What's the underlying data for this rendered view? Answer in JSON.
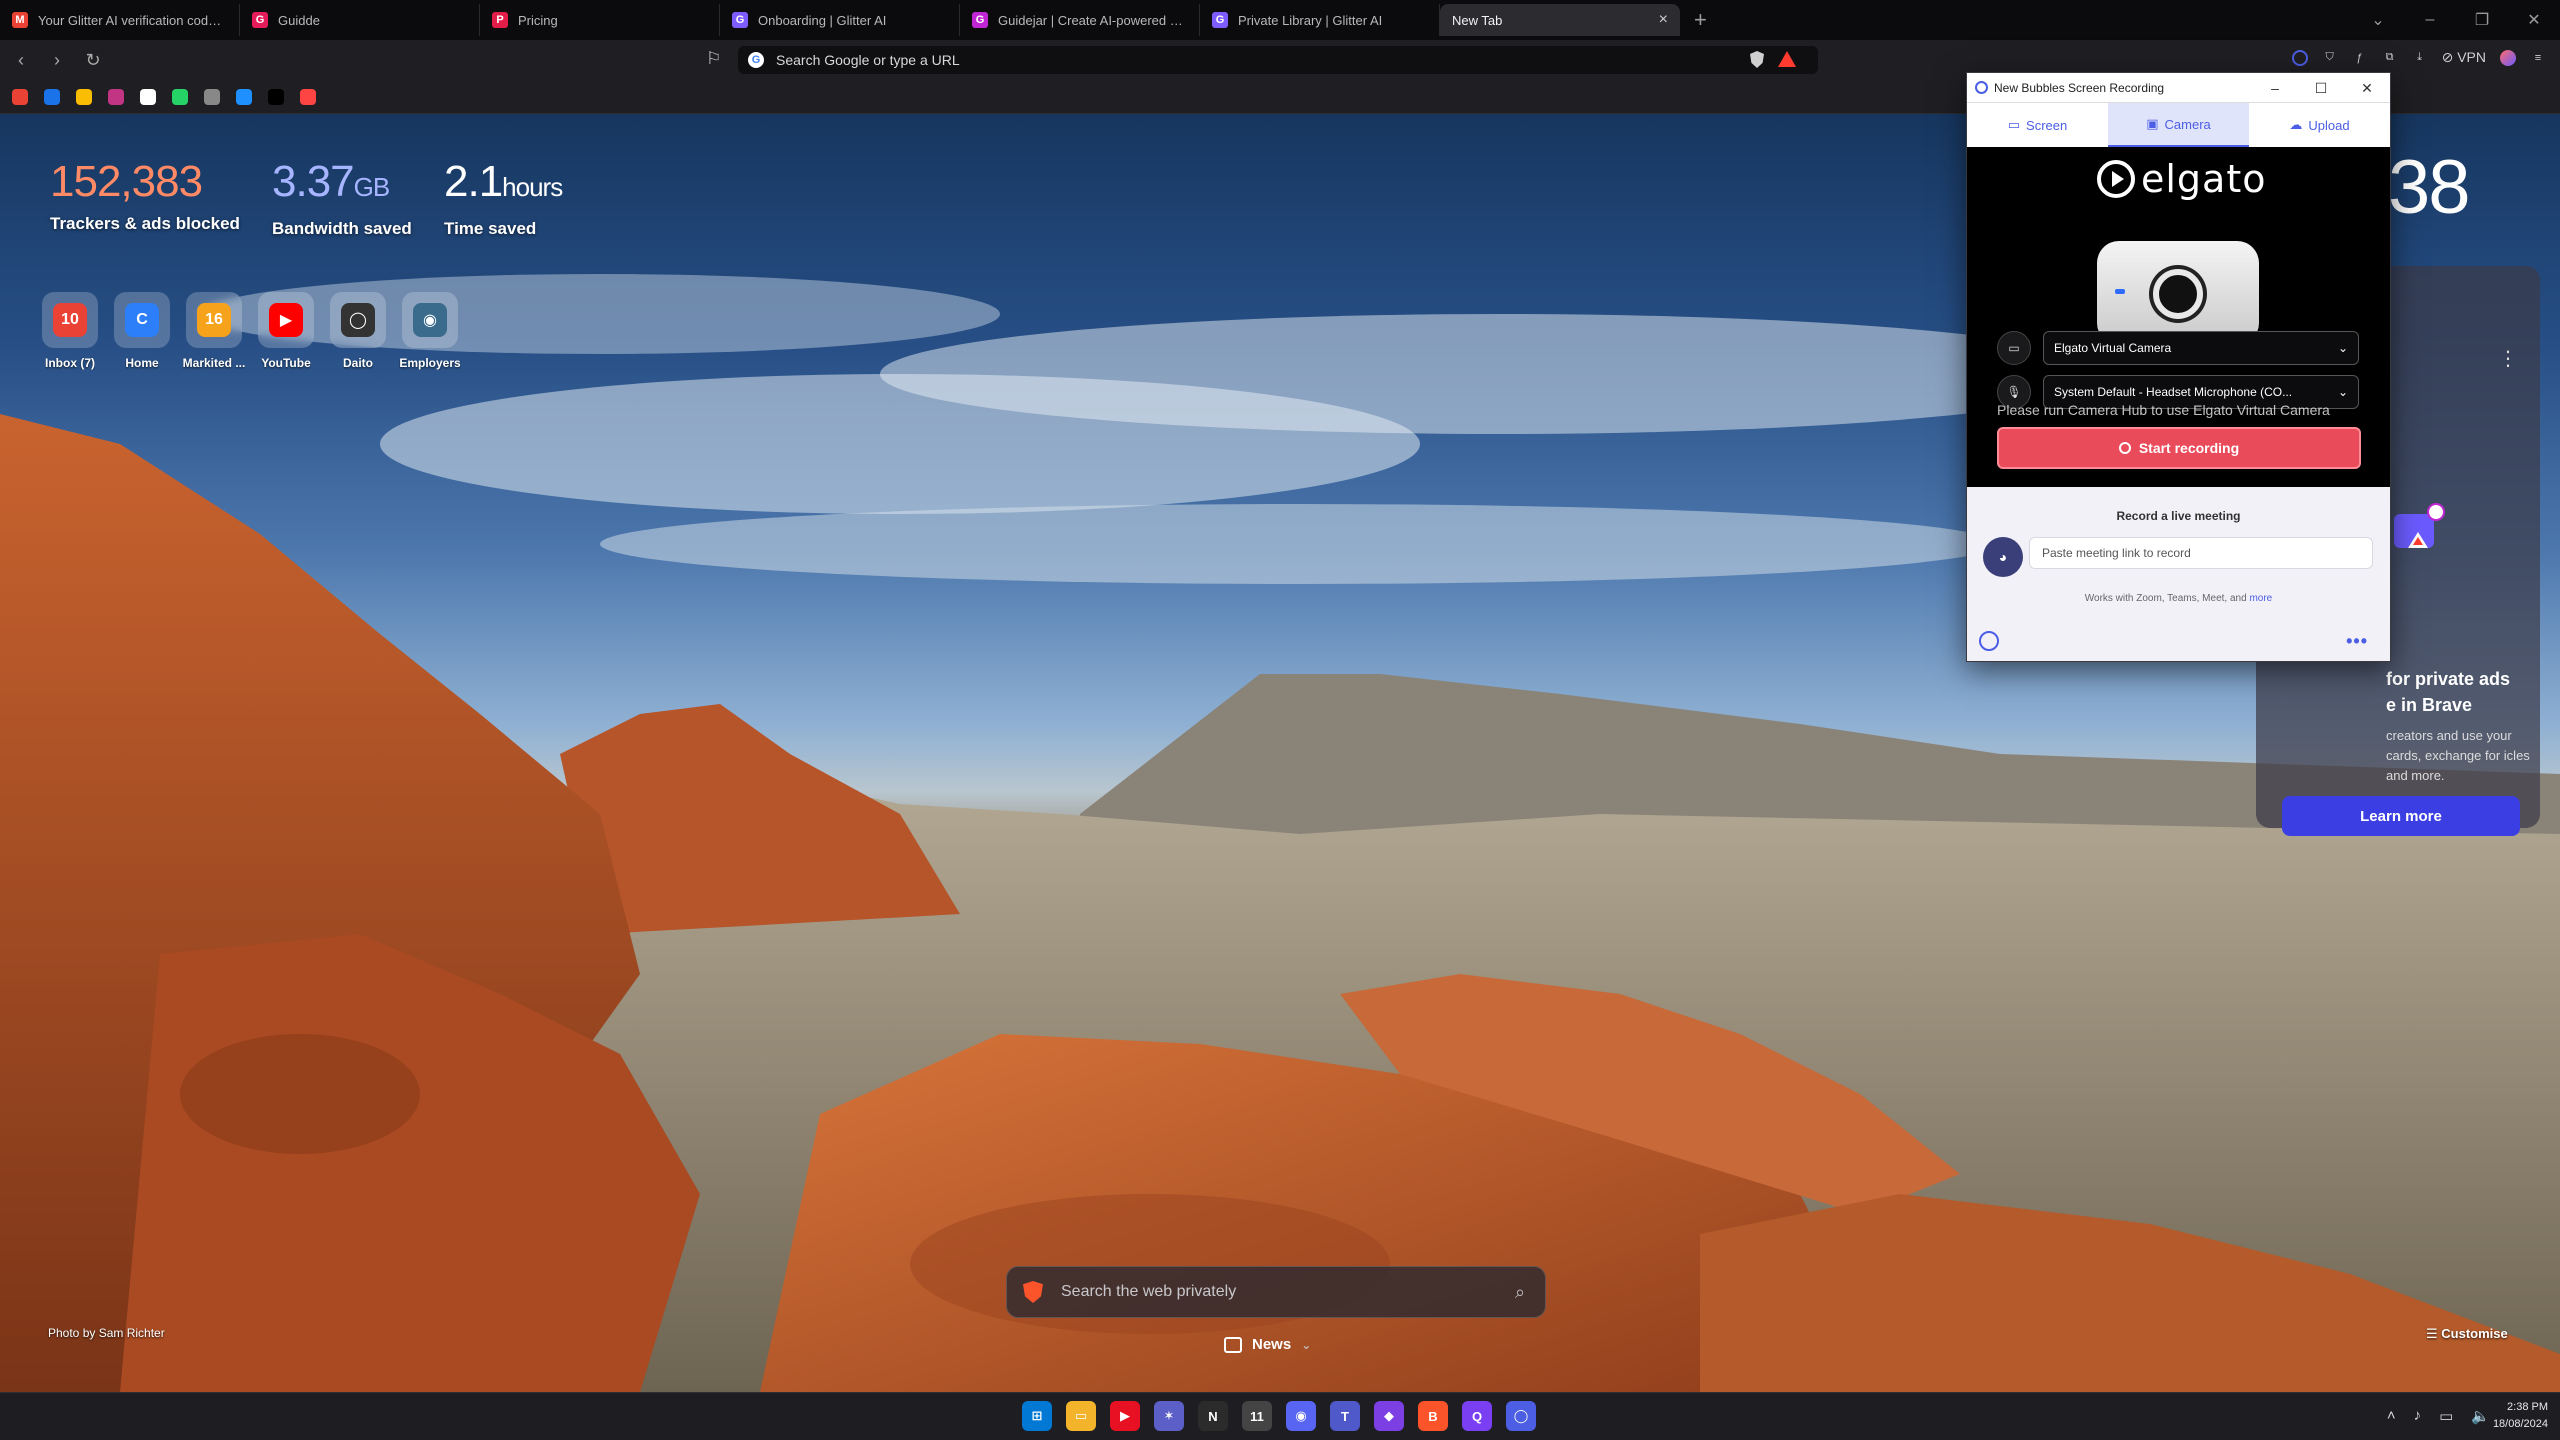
{
  "tabs": [
    {
      "title": "Your Glitter AI verification code - p...",
      "favicon_color": "#ea4335",
      "favicon_glyph": "M"
    },
    {
      "title": "Guidde",
      "favicon_color": "#e61b5a",
      "favicon_glyph": "G"
    },
    {
      "title": "Pricing",
      "favicon_color": "#e11d48",
      "favicon_glyph": "P"
    },
    {
      "title": "Onboarding | Glitter AI",
      "favicon_color": "#7c5cff",
      "favicon_glyph": "G"
    },
    {
      "title": "Guidejar | Create AI-powered step-...",
      "favicon_color": "#c026d3",
      "favicon_glyph": "G"
    },
    {
      "title": "Private Library | Glitter AI",
      "favicon_color": "#7c5cff",
      "favicon_glyph": "G"
    },
    {
      "title": "New Tab",
      "favicon_color": "",
      "favicon_glyph": ""
    }
  ],
  "new_tab_glyph": "+",
  "toolbar": {
    "url_placeholder": "Search Google or type a URL",
    "vpn_label": "VPN"
  },
  "bookmark_colors": [
    "#ea4335",
    "#1a73e8",
    "#fbbc04",
    "#c13584",
    "#ffffff",
    "#25d366",
    "#888888",
    "#1e90ff",
    "#000000",
    "#ff4444"
  ],
  "stats": {
    "trackers_value": "152,383",
    "trackers_label": "Trackers & ads blocked",
    "bandwidth_value": "3.37",
    "bandwidth_unit": "GB",
    "bandwidth_label": "Bandwidth saved",
    "time_value": "2.1",
    "time_unit": "hours",
    "time_label": "Time saved",
    "colors": {
      "trackers": "#ff8a65",
      "bandwidth": "#a7b4ff",
      "time": "#ffffff"
    }
  },
  "top_sites": [
    {
      "name": "Inbox (7)",
      "badge": "10",
      "color": "#ea4335",
      "icon": "gmail-icon"
    },
    {
      "name": "Home",
      "badge": "C",
      "color": "#2d7ff9",
      "icon": "canva-icon"
    },
    {
      "name": "Markited ...",
      "badge": "16",
      "color": "#f7a21b",
      "icon": "calendar-icon"
    },
    {
      "name": "YouTube",
      "badge": "▶",
      "color": "#ff0000",
      "icon": "youtube-icon"
    },
    {
      "name": "Daito",
      "badge": "◯",
      "color": "#333333",
      "icon": "daito-icon"
    },
    {
      "name": "Employers",
      "badge": "◉",
      "color": "#3a6b8c",
      "icon": "employers-icon"
    }
  ],
  "clock_fragment": "38",
  "promo": {
    "headline_1": "for private ads",
    "headline_2": "e in Brave",
    "body": "creators and use your cards, exchange for icles and more.",
    "button": "Learn more"
  },
  "search": {
    "placeholder": "Search the web privately"
  },
  "news_label": "News",
  "photo_credit": "Photo by Sam Richter",
  "customise_label": "Customise",
  "bubbles": {
    "window_title": "New Bubbles Screen Recording",
    "tabs": [
      {
        "label": "Screen",
        "icon": "monitor-icon"
      },
      {
        "label": "Camera",
        "icon": "camera-icon",
        "active": true
      },
      {
        "label": "Upload",
        "icon": "cloud-upload-icon"
      }
    ],
    "brand_text": "elgato",
    "camera_select": "Elgato Virtual Camera",
    "mic_select": "System Default - Headset Microphone (CO...",
    "hint_text": "Please run Camera Hub to use Elgato Virtual Camera",
    "start_button": "Start recording",
    "meeting_heading": "Record a live meeting",
    "meeting_placeholder": "Paste meeting link to record",
    "works_with": "Works with Zoom, Teams, Meet, and",
    "works_more": "more",
    "start_color": "#ea4b5a",
    "accent_color": "#4b5ee4"
  },
  "taskbar": {
    "apps": [
      {
        "name": "windows-start",
        "color": "#0078d4",
        "glyph": "⊞"
      },
      {
        "name": "file-explorer",
        "color": "#f3b32a",
        "glyph": "▭"
      },
      {
        "name": "media-player",
        "color": "#e81123",
        "glyph": "▶"
      },
      {
        "name": "app-star",
        "color": "#5b5fc7",
        "glyph": "✶"
      },
      {
        "name": "notion",
        "color": "#2b2b2b",
        "glyph": "N"
      },
      {
        "name": "calendar",
        "color": "#444444",
        "glyph": "11"
      },
      {
        "name": "discord",
        "color": "#5865f2",
        "glyph": "◉"
      },
      {
        "name": "teams",
        "color": "#5059c9",
        "glyph": "T"
      },
      {
        "name": "clipchamp",
        "color": "#7b3fe4",
        "glyph": "◆"
      },
      {
        "name": "brave",
        "color": "#fb542b",
        "glyph": "B"
      },
      {
        "name": "qbittorrent",
        "color": "#7a3ff2",
        "glyph": "Q"
      },
      {
        "name": "bubbles",
        "color": "#4b5ee4",
        "glyph": "◯"
      }
    ],
    "time": "2:38 PM",
    "date": "18/08/2024"
  }
}
